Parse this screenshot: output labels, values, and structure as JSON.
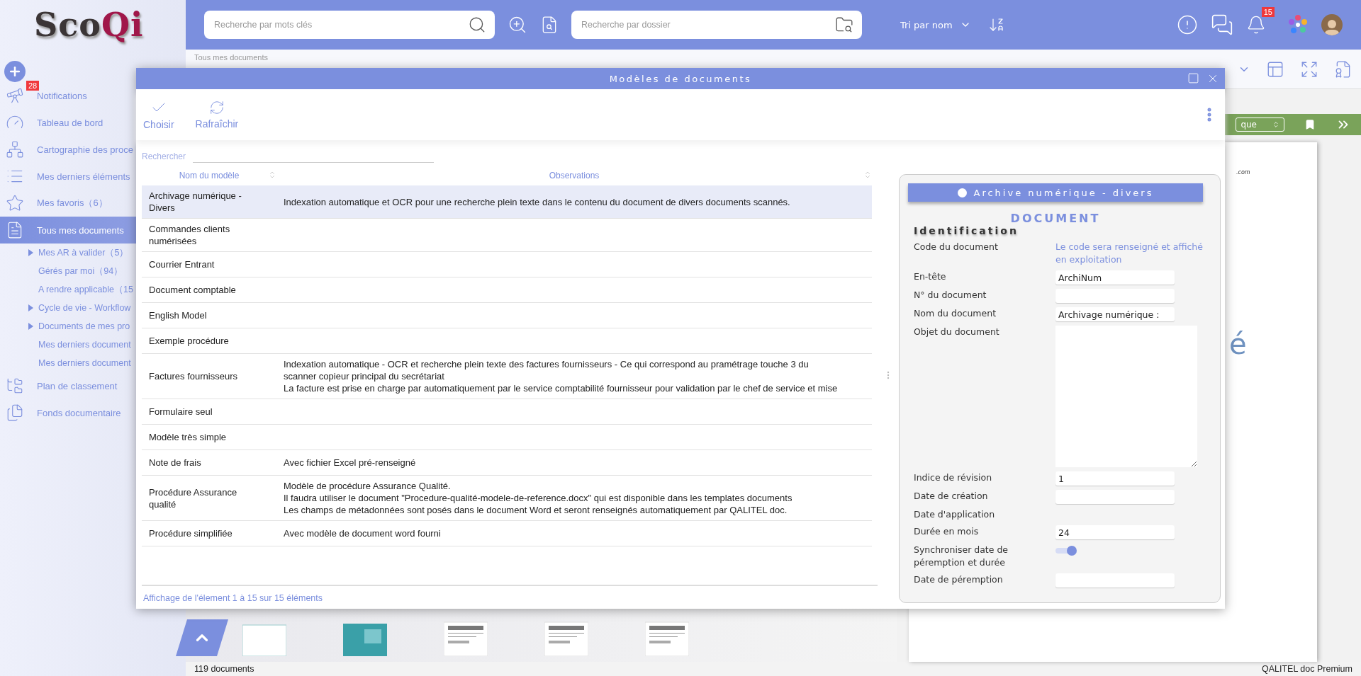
{
  "logo": [
    "Sco",
    "Qi"
  ],
  "sidebar": {
    "items": [
      {
        "label": "Notifications",
        "kind": "telescope",
        "badge": "28",
        "selected": false
      },
      {
        "label": "Tableau de bord",
        "kind": "gauge",
        "selected": false
      },
      {
        "label": "Cartographie des proce",
        "kind": "network",
        "selected": false
      },
      {
        "label": "Mes derniers éléments",
        "kind": "list",
        "selected": false
      },
      {
        "label": "Mes favoris（6）",
        "kind": "star",
        "selected": false
      },
      {
        "label": "Tous mes documents",
        "kind": "document",
        "selected": true,
        "children": [
          {
            "label": "Mes AR à valider（5）",
            "has_children": true
          },
          {
            "label": "Gérés par moi（94）",
            "has_children": false
          },
          {
            "label": "A rendre applicable（15",
            "has_children": false
          },
          {
            "label": "Cycle de vie - Workflow",
            "has_children": true
          },
          {
            "label": "Documents de mes pro",
            "has_children": true
          },
          {
            "label": "Mes derniers document",
            "has_children": false
          },
          {
            "label": "Mes derniers document",
            "has_children": false
          }
        ]
      },
      {
        "label": "Plan de classement",
        "kind": "tree",
        "selected": false
      },
      {
        "label": "Fonds documentaire",
        "kind": "files",
        "selected": false
      }
    ]
  },
  "topbar": {
    "search_placeholder": "Recherche par mots clés",
    "folder_placeholder": "Recherche par dossier",
    "sort_label": "Tri par nom",
    "bell_badge": "15"
  },
  "breadcrumb": "Tous mes documents",
  "viewer": {
    "select_value": "que",
    "page_texts": [
      ".com",
      "é"
    ]
  },
  "thumbnails": [
    {
      "kind": "blank"
    },
    {
      "kind": "teal"
    },
    {
      "kind": "form"
    },
    {
      "kind": "form"
    },
    {
      "kind": "form"
    }
  ],
  "dialog": {
    "title": "Modèles de documents",
    "actions": [
      {
        "label": "Choisir",
        "kind": "choose"
      },
      {
        "label": "Rafraîchir",
        "kind": "refresh"
      }
    ],
    "search_label": "Rechercher",
    "columns": [
      "Nom du modèle",
      "Observations"
    ],
    "rows": [
      {
        "name": "Archivage numérique - Divers",
        "observations": [
          "Indexation automatique et OCR pour une recherche plein texte dans le contenu du document de divers documents scannés."
        ],
        "selected": true
      },
      {
        "name": "Commandes clients numérisées",
        "observations": [],
        "selected": false
      },
      {
        "name": "Courrier Entrant",
        "observations": [],
        "selected": false
      },
      {
        "name": "Document comptable",
        "observations": [],
        "selected": false
      },
      {
        "name": "English Model",
        "observations": [],
        "selected": false
      },
      {
        "name": "Exemple procédure",
        "observations": [],
        "selected": false
      },
      {
        "name": "Factures fournisseurs",
        "observations": [
          "Indexation automatique - OCR et recherche plein texte des factures fournisseurs - Ce qui correspond au pramétrage touche 3 du",
          "scanner copieur principal du secrétariat",
          "La facture est prise en charge par automatiquement par le service comptabilité fournisseur pour validation par le chef de service et mise"
        ],
        "selected": false
      },
      {
        "name": "Formulaire seul",
        "observations": [],
        "selected": false
      },
      {
        "name": "Modèle très simple",
        "observations": [],
        "selected": false
      },
      {
        "name": "Note de frais",
        "observations": [
          "Avec fichier Excel pré-renseigné"
        ],
        "selected": false
      },
      {
        "name": "Procédure Assurance qualité",
        "observations": [
          "Modèle de procédure Assurance Qualité.",
          "Il faudra utiliser le document \"Procedure-qualité-modele-de-reference.docx\" qui est disponible dans les templates documents",
          "Les champs de métadonnées sont posés dans le document Word et seront renseignés automatiquement par QALITEL doc."
        ],
        "selected": false
      },
      {
        "name": "Procédure simplifiée",
        "observations": [
          "Avec modèle de document word fourni"
        ],
        "selected": false
      }
    ],
    "footer": "Affichage de l'élement 1 à 15 sur 15 éléments",
    "form": {
      "banner": "Archive numérique - divers",
      "heading": "DOCUMENT",
      "section": "Identification",
      "fields": [
        {
          "label": "Code du document",
          "kind": "note",
          "value": "Le code sera renseigné et affiché en exploitation"
        },
        {
          "label": "En-tête",
          "kind": "input",
          "value": "ArchiNum"
        },
        {
          "label": "N° du document",
          "kind": "input"
        },
        {
          "label": "Nom du document",
          "kind": "input",
          "value": "Archivage numérique :"
        },
        {
          "label": "Objet du document",
          "kind": "textarea"
        },
        {
          "label": "Indice de révision",
          "kind": "input",
          "value": "1"
        },
        {
          "label": "Date de création",
          "kind": "input"
        },
        {
          "label": "Date d'application",
          "kind": "none"
        },
        {
          "label": "Durée en mois",
          "kind": "input",
          "value": "24"
        },
        {
          "label": "Synchroniser date de péremption et durée",
          "kind": "toggle",
          "on": true
        },
        {
          "label": "Date de péremption",
          "kind": "input"
        }
      ]
    }
  },
  "status": {
    "count": "119 documents",
    "product": "QALITEL doc Premium"
  }
}
